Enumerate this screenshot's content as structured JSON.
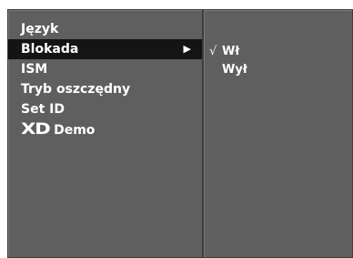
{
  "menu": {
    "items": [
      {
        "label": "Język",
        "selected": false
      },
      {
        "label": "Blokada",
        "selected": true,
        "arrow": "▶"
      },
      {
        "label": "ISM",
        "selected": false
      },
      {
        "label": "Tryb oszczędny",
        "selected": false
      },
      {
        "label": "Set ID",
        "selected": false
      },
      {
        "logo": "XD",
        "label": "Demo",
        "selected": false
      }
    ]
  },
  "submenu": {
    "items": [
      {
        "label": "Wł",
        "checked": true,
        "check_mark": "√"
      },
      {
        "label": "Wył",
        "checked": false
      }
    ]
  },
  "colors": {
    "panel": "#5f5f5f",
    "highlight": "#141414",
    "text": "#ffffff"
  }
}
